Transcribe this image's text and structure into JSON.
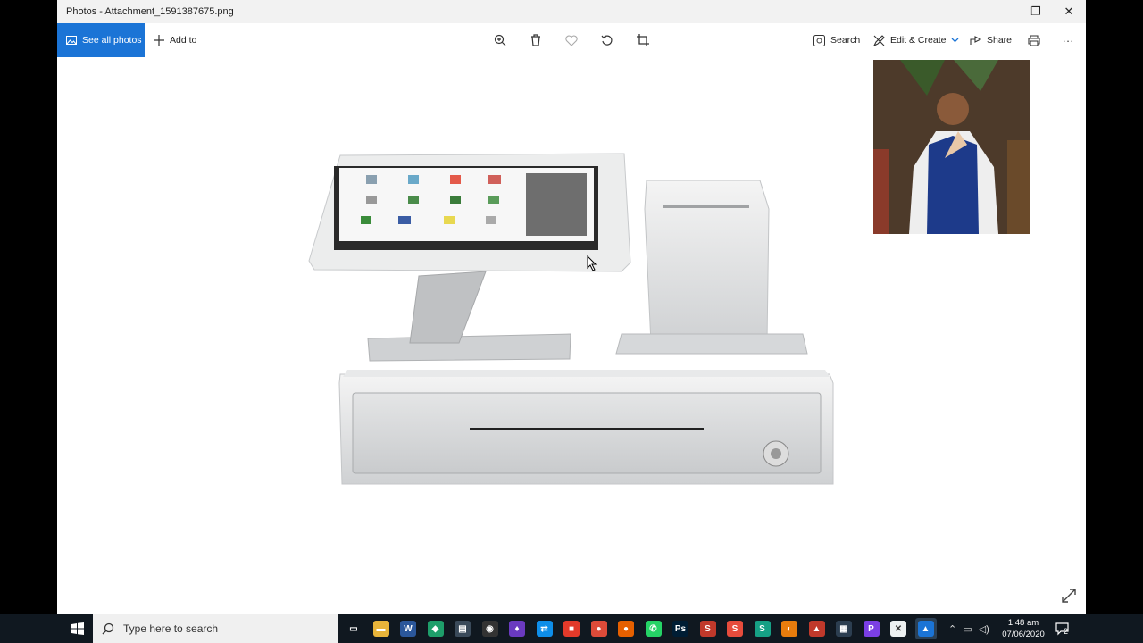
{
  "window": {
    "title": "Photos - Attachment_1591387675.png",
    "minimize_glyph": "—",
    "maximize_glyph": "❐",
    "close_glyph": "✕"
  },
  "commandbar": {
    "see_all_label": "See all photos",
    "add_to_label": "Add to",
    "search_label": "Search",
    "edit_create_label": "Edit & Create",
    "share_label": "Share",
    "more_glyph": "···"
  },
  "photo": {
    "subject_icon": "pos-terminal-illustration",
    "inset_icon": "person-portrait-photo"
  },
  "taskbar": {
    "search_placeholder": "Type here to search",
    "clock_time": "1:48 am",
    "clock_date": "07/06/2020",
    "notification_count": "2",
    "apps": [
      {
        "name": "task-view",
        "color": "#101820",
        "glyph": "▭"
      },
      {
        "name": "file-explorer",
        "color": "#e8b43a",
        "glyph": "▬"
      },
      {
        "name": "word",
        "color": "#2b579a",
        "glyph": "W"
      },
      {
        "name": "app-green",
        "color": "#1e9e6a",
        "glyph": "◆"
      },
      {
        "name": "app-notes",
        "color": "#3a4a5a",
        "glyph": "▤"
      },
      {
        "name": "obs",
        "color": "#333",
        "glyph": "◉"
      },
      {
        "name": "app-purple",
        "color": "#6a3ac0",
        "glyph": "♦"
      },
      {
        "name": "teamviewer",
        "color": "#0e8ee9",
        "glyph": "⇄"
      },
      {
        "name": "app-red",
        "color": "#e23a2a",
        "glyph": "■"
      },
      {
        "name": "chrome",
        "color": "#dd4b39",
        "glyph": "●"
      },
      {
        "name": "firefox",
        "color": "#e66000",
        "glyph": "●"
      },
      {
        "name": "whatsapp",
        "color": "#25d366",
        "glyph": "✆"
      },
      {
        "name": "photoshop",
        "color": "#001d34",
        "glyph": "Ps"
      },
      {
        "name": "app-red-2",
        "color": "#c0392b",
        "glyph": "S"
      },
      {
        "name": "app-red-3",
        "color": "#e74c3c",
        "glyph": "S"
      },
      {
        "name": "app-teal",
        "color": "#16a085",
        "glyph": "S"
      },
      {
        "name": "blender",
        "color": "#e87d0d",
        "glyph": "◐"
      },
      {
        "name": "sketchup",
        "color": "#c0392b",
        "glyph": "▲"
      },
      {
        "name": "app-blue-grid",
        "color": "#2c3e50",
        "glyph": "▦"
      },
      {
        "name": "app-purple-2",
        "color": "#7b3fe4",
        "glyph": "P"
      },
      {
        "name": "app-crossed",
        "color": "#ecf0f1",
        "glyph": "✕"
      },
      {
        "name": "photos",
        "color": "#1b74d6",
        "glyph": "▲"
      }
    ]
  }
}
